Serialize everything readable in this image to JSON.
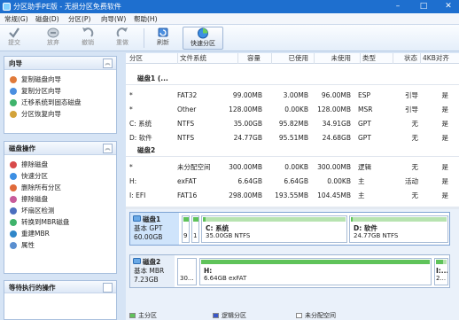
{
  "window": {
    "title": "分区助手PE版 - 无损分区免费软件",
    "controls": {
      "minimize": "–",
      "maximize": "□",
      "close": "✕"
    }
  },
  "menu": [
    "常规(G)",
    "磁盘(D)",
    "分区(P)",
    "向导(W)",
    "帮助(H)"
  ],
  "toolbar": {
    "items": [
      {
        "label": "提交",
        "icon": "check-icon",
        "enabled": false
      },
      {
        "label": "放弃",
        "icon": "discard-icon",
        "enabled": false
      },
      {
        "label": "撤销",
        "icon": "undo-icon",
        "enabled": false
      },
      {
        "label": "重做",
        "icon": "redo-icon",
        "enabled": false
      },
      {
        "label": "刷新",
        "icon": "refresh-icon",
        "enabled": true
      },
      {
        "label": "快速分区",
        "icon": "quick-partition-icon",
        "enabled": true
      }
    ]
  },
  "wizard_panel": {
    "title": "向导",
    "items": [
      "复制磁盘向导",
      "复制分区向导",
      "迁移系统到固态磁盘",
      "分区恢复向导"
    ]
  },
  "disk_ops_panel": {
    "title": "磁盘操作",
    "items": [
      "擦除磁盘",
      "快速分区",
      "删除所有分区",
      "擦除磁盘",
      "坏扇区检测",
      "转换到MBR磁盘",
      "重建MBR",
      "属性"
    ]
  },
  "pending_panel": {
    "title": "等待执行的操作"
  },
  "table": {
    "columns": [
      "分区",
      "文件系统",
      "容量",
      "已使用",
      "未使用",
      "类型",
      "状态",
      "4KB对齐"
    ],
    "disks": [
      {
        "header": "磁盘1 (...",
        "rows": [
          [
            "*",
            "FAT32",
            "99.00MB",
            "3.00MB",
            "96.00MB",
            "ESP",
            "引导",
            "是"
          ],
          [
            "*",
            "Other",
            "128.00MB",
            "0.00KB",
            "128.00MB",
            "MSR",
            "引导",
            "是"
          ],
          [
            "C: 系统",
            "NTFS",
            "35.00GB",
            "95.82MB",
            "34.91GB",
            "GPT",
            "无",
            "是"
          ],
          [
            "D: 软件",
            "NTFS",
            "24.77GB",
            "95.51MB",
            "24.68GB",
            "GPT",
            "无",
            "是"
          ]
        ]
      },
      {
        "header": "磁盘2",
        "rows": [
          [
            "*",
            "未分配空间",
            "300.00MB",
            "0.00KB",
            "300.00MB",
            "逻辑",
            "无",
            "是"
          ],
          [
            "H:",
            "exFAT",
            "6.64GB",
            "6.64GB",
            "0.00KB",
            "主",
            "活动",
            "是"
          ],
          [
            "I: EFI",
            "FAT16",
            "298.00MB",
            "193.55MB",
            "104.45MB",
            "主",
            "无",
            "是"
          ]
        ]
      }
    ]
  },
  "disk_map": {
    "disk1": {
      "name": "磁盘1",
      "info1": "基本 GPT",
      "info2": "60.00GB",
      "small1": "9",
      "small2": "1",
      "partC": {
        "name": "C: 系统",
        "info": "35.00GB NTFS",
        "used_fraction": 0.02
      },
      "partD": {
        "name": "D: 软件",
        "info": "24.77GB NTFS",
        "used_fraction": 0.02
      }
    },
    "disk2": {
      "name": "磁盘2",
      "info1": "基本 MBR",
      "info2": "7.23GB",
      "unalloc": "30...",
      "partH": {
        "name": "H:",
        "info": "6.64GB exFAT",
        "used_fraction": 1.0
      },
      "partI": {
        "name": "I:...",
        "info": "2...",
        "used_fraction": 0.65
      }
    }
  },
  "legend": [
    "主分区",
    "逻辑分区",
    "未分配空间"
  ],
  "colors": {
    "titlebar": "#1e6fcf",
    "selected_disk": "#cfe4fb",
    "primary": "#5fc35a",
    "primary_light": "#b7e3b0",
    "logical": "#3a57c9",
    "unallocated": "#ffffff"
  }
}
